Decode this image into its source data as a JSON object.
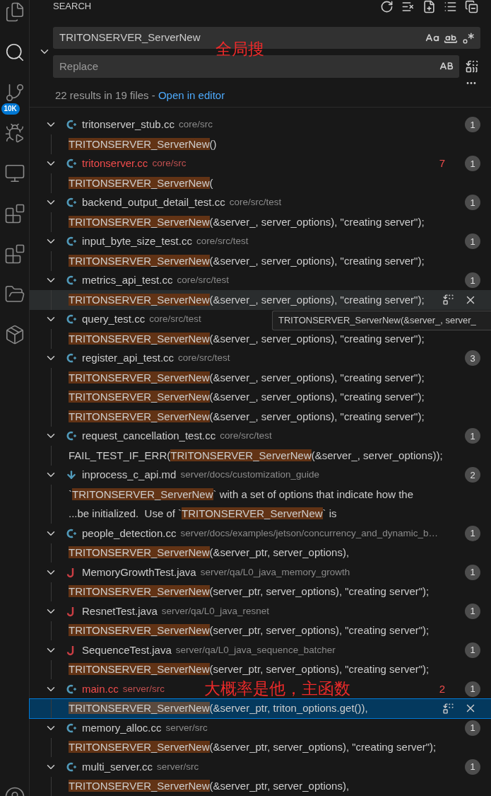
{
  "activity_bar": {
    "source_control_badge": "10K"
  },
  "panel": {
    "title": "SEARCH"
  },
  "search": {
    "value": "TRITONSERVER_ServerNew",
    "note": "全局搜"
  },
  "replace": {
    "placeholder": "Replace"
  },
  "summary": {
    "text": "22 results in 19 files - ",
    "link": "Open in editor"
  },
  "files": [
    {
      "kind": "cpp",
      "name": "tritonserver_stub.cc",
      "path": "core/src",
      "modified": false,
      "count": "1",
      "expanded": true,
      "matches": [
        {
          "match": "TRITONSERVER_ServerNew",
          "post": "()",
          "selected": false,
          "hovered": false
        }
      ]
    },
    {
      "kind": "cpp",
      "name": "tritonserver.cc",
      "path": "core/src",
      "modified": true,
      "problems": "7",
      "count": "1",
      "expanded": true,
      "matches": [
        {
          "match": "TRITONSERVER_ServerNew",
          "post": "(",
          "selected": false,
          "hovered": false
        }
      ]
    },
    {
      "kind": "cpp",
      "name": "backend_output_detail_test.cc",
      "path": "core/src/test",
      "modified": false,
      "count": "1",
      "expanded": true,
      "matches": [
        {
          "match": "TRITONSERVER_ServerNew",
          "post": "(&server_, server_options), \"creating server\");",
          "selected": false,
          "hovered": false
        }
      ]
    },
    {
      "kind": "cpp",
      "name": "input_byte_size_test.cc",
      "path": "core/src/test",
      "modified": false,
      "count": "1",
      "expanded": true,
      "matches": [
        {
          "match": "TRITONSERVER_ServerNew",
          "post": "(&server_, server_options), \"creating server\");",
          "selected": false,
          "hovered": false
        }
      ]
    },
    {
      "kind": "cpp",
      "name": "metrics_api_test.cc",
      "path": "core/src/test",
      "modified": false,
      "count": "1",
      "expanded": true,
      "matches": [
        {
          "match": "TRITONSERVER_ServerNew",
          "post": "(&server_, server_options), \"creating server\");",
          "selected": false,
          "hovered": true
        }
      ]
    },
    {
      "kind": "cpp",
      "name": "query_test.cc",
      "path": "core/src/test",
      "modified": false,
      "expanded": true,
      "tooltip": "TRITONSERVER_ServerNew(&server_, server_",
      "matches": [
        {
          "match": "TRITONSERVER_ServerNew",
          "post": "(&server_, server_options), \"creating server\");",
          "selected": false,
          "hovered": false
        }
      ]
    },
    {
      "kind": "cpp",
      "name": "register_api_test.cc",
      "path": "core/src/test",
      "modified": false,
      "count": "3",
      "expanded": true,
      "matches": [
        {
          "match": "TRITONSERVER_ServerNew",
          "post": "(&server_, server_options), \"creating server\");",
          "selected": false,
          "hovered": false
        },
        {
          "match": "TRITONSERVER_ServerNew",
          "post": "(&server_, server_options), \"creating server\");",
          "selected": false,
          "hovered": false
        },
        {
          "match": "TRITONSERVER_ServerNew",
          "post": "(&server_, server_options), \"creating server\");",
          "selected": false,
          "hovered": false
        }
      ]
    },
    {
      "kind": "cpp",
      "name": "request_cancellation_test.cc",
      "path": "core/src/test",
      "modified": false,
      "count": "1",
      "expanded": true,
      "matches": [
        {
          "pre": "FAIL_TEST_IF_ERR(",
          "match": "TRITONSERVER_ServerNew",
          "post": "(&server_, server_options));",
          "selected": false,
          "hovered": false
        }
      ]
    },
    {
      "kind": "md",
      "name": "inprocess_c_api.md",
      "path": "server/docs/customization_guide",
      "modified": false,
      "count": "2",
      "expanded": true,
      "matches": [
        {
          "pre": "`",
          "match": "TRITONSERVER_ServerNew",
          "post": "` with a set of options that indicate how the",
          "selected": false,
          "hovered": false
        },
        {
          "pre": "...be initialized.  Use of `",
          "match": "TRITONSERVER_ServerNew",
          "post": "` is",
          "selected": false,
          "hovered": false
        }
      ]
    },
    {
      "kind": "cpp",
      "name": "people_detection.cc",
      "path": "server/docs/examples/jetson/concurrency_and_dynamic_b…",
      "modified": false,
      "count": "1",
      "expanded": true,
      "matches": [
        {
          "match": "TRITONSERVER_ServerNew",
          "post": "(&server_ptr, server_options),",
          "selected": false,
          "hovered": false
        }
      ]
    },
    {
      "kind": "java",
      "name": "MemoryGrowthTest.java",
      "path": "server/qa/L0_java_memory_growth",
      "modified": false,
      "count": "1",
      "expanded": true,
      "matches": [
        {
          "match": "TRITONSERVER_ServerNew",
          "post": "(server_ptr, server_options), \"creating server\");",
          "selected": false,
          "hovered": false
        }
      ]
    },
    {
      "kind": "java",
      "name": "ResnetTest.java",
      "path": "server/qa/L0_java_resnet",
      "modified": false,
      "count": "1",
      "expanded": true,
      "matches": [
        {
          "match": "TRITONSERVER_ServerNew",
          "post": "(server_ptr, server_options), \"creating server\");",
          "selected": false,
          "hovered": false
        }
      ]
    },
    {
      "kind": "java",
      "name": "SequenceTest.java",
      "path": "server/qa/L0_java_sequence_batcher",
      "modified": false,
      "count": "1",
      "expanded": true,
      "matches": [
        {
          "match": "TRITONSERVER_ServerNew",
          "post": "(server_ptr, server_options), \"creating server\");",
          "selected": false,
          "hovered": false
        }
      ]
    },
    {
      "kind": "cpp",
      "name": "main.cc",
      "path": "server/src",
      "modified": true,
      "problems": "2",
      "count": "1",
      "expanded": true,
      "note": "大概率是他，主函数",
      "matches": [
        {
          "match": "TRITONSERVER_ServerNew",
          "post": "(&server_ptr, triton_options.get()),",
          "selected": true,
          "hovered": false
        }
      ]
    },
    {
      "kind": "cpp",
      "name": "memory_alloc.cc",
      "path": "server/src",
      "modified": false,
      "count": "1",
      "expanded": true,
      "matches": [
        {
          "match": "TRITONSERVER_ServerNew",
          "post": "(&server_ptr, server_options), \"creating server\");",
          "selected": false,
          "hovered": false
        }
      ]
    },
    {
      "kind": "cpp",
      "name": "multi_server.cc",
      "path": "server/src",
      "modified": false,
      "count": "1",
      "expanded": true,
      "matches": [
        {
          "match": "TRITONSERVER_ServerNew",
          "post": "(&server_ptr, server_options),",
          "selected": false,
          "hovered": false
        }
      ]
    }
  ]
}
